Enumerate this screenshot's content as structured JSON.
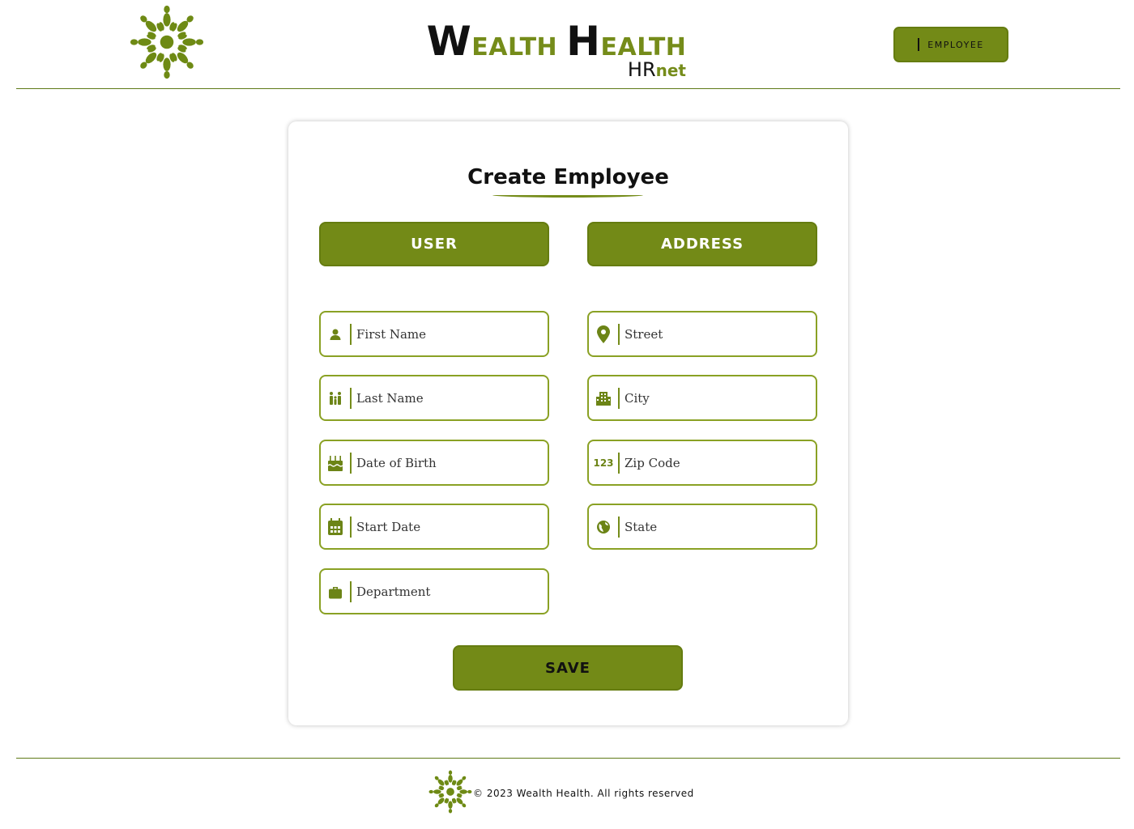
{
  "header": {
    "brand_first_cap": "W",
    "brand_first_rest": "EALTH",
    "brand_second_cap": "H",
    "brand_second_rest": "EALTH",
    "brand_sub_hr": "HR",
    "brand_sub_net": "net",
    "employee_button": "EMPLOYEE"
  },
  "form": {
    "title": "Create Employee",
    "user_section": "USER",
    "address_section": "ADDRESS",
    "user_fields": [
      {
        "placeholder": "First Name",
        "icon": "person-icon"
      },
      {
        "placeholder": "Last Name",
        "icon": "family-icon"
      },
      {
        "placeholder": "Date of Birth",
        "icon": "birthday-cake-icon"
      },
      {
        "placeholder": "Start Date",
        "icon": "calendar-icon"
      },
      {
        "placeholder": "Department",
        "icon": "briefcase-icon"
      }
    ],
    "address_fields": [
      {
        "placeholder": "Street",
        "icon": "location-pin-icon"
      },
      {
        "placeholder": "City",
        "icon": "building-icon"
      },
      {
        "placeholder": "Zip Code",
        "icon": "numbers-icon",
        "icon_text": "123"
      },
      {
        "placeholder": "State",
        "icon": "globe-icon"
      }
    ],
    "save_label": "SAVE"
  },
  "footer": {
    "copyright": "© 2023 Wealth Health. All rights reserved"
  },
  "colors": {
    "accent": "#738a17",
    "accent_border": "#657c10",
    "field_border": "#8aa124"
  }
}
